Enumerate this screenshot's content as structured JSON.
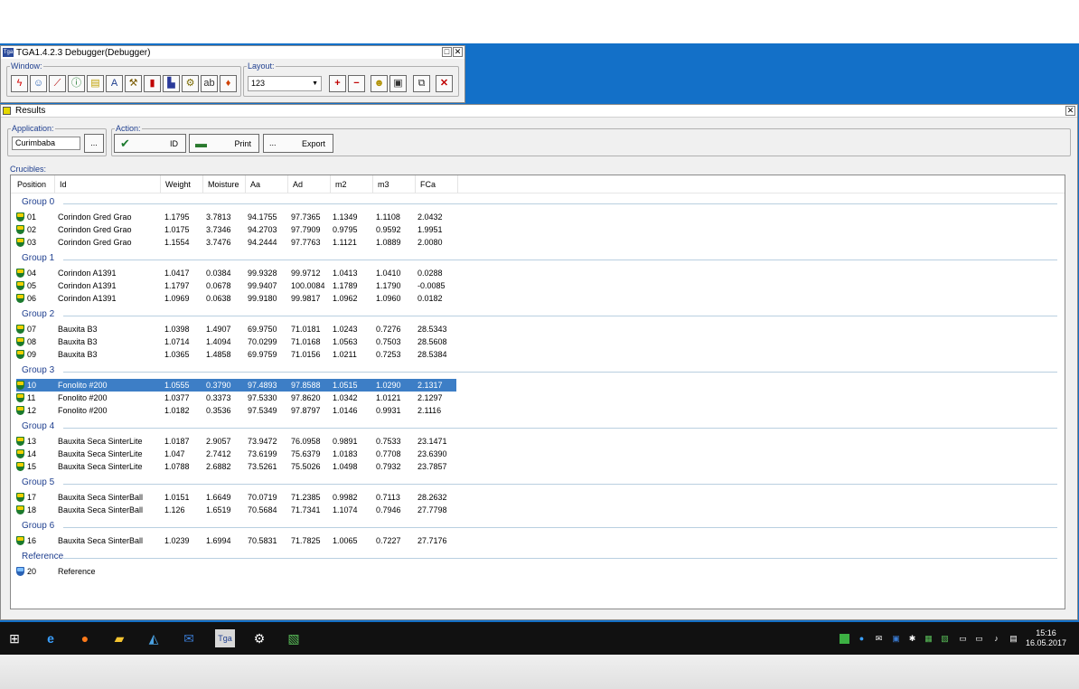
{
  "debugger": {
    "icon_text": "Tga",
    "title": "TGA1.4.2.3 Debugger(Debugger)",
    "window_label": "Window:",
    "layout_label": "Layout:",
    "layout_value": "123",
    "window_tools": [
      "lightning-icon",
      "smiley-icon",
      "chart-icon",
      "info-icon",
      "note-icon",
      "text-a-icon",
      "tool-icon",
      "battery-icon",
      "book-icon",
      "gear-icon",
      "abc-icon",
      "bell-icon"
    ],
    "layout_tools": [
      "plus-icon",
      "minus-icon",
      "yellow-face-icon",
      "screen-icon",
      "copy-icon",
      "close-icon"
    ]
  },
  "results": {
    "title": "Results",
    "application_label": "Application:",
    "application_value": "Curimbaba",
    "browse_label": "...",
    "action_label": "Action:",
    "id_button": "ID",
    "print_button": "Print",
    "export_button": "Export",
    "export_dots": "...",
    "crucibles_label": "Crucibles:",
    "columns": [
      "Position",
      "Id",
      "Weight",
      "Moisture",
      "Aa",
      "Ad",
      "m2",
      "m3",
      "FCa"
    ],
    "groups": [
      {
        "name": "Group 0",
        "rows": [
          {
            "pos": "01",
            "id": "Corindon Gred Grao",
            "weight": "1.1795",
            "moisture": "3.7813",
            "aa": "94.1755",
            "ad": "97.7365",
            "m2": "1.1349",
            "m3": "1.1108",
            "fca": "2.0432"
          },
          {
            "pos": "02",
            "id": "Corindon Gred Grao",
            "weight": "1.0175",
            "moisture": "3.7346",
            "aa": "94.2703",
            "ad": "97.7909",
            "m2": "0.9795",
            "m3": "0.9592",
            "fca": "1.9951"
          },
          {
            "pos": "03",
            "id": "Corindon Gred Grao",
            "weight": "1.1554",
            "moisture": "3.7476",
            "aa": "94.2444",
            "ad": "97.7763",
            "m2": "1.1121",
            "m3": "1.0889",
            "fca": "2.0080"
          }
        ]
      },
      {
        "name": "Group 1",
        "rows": [
          {
            "pos": "04",
            "id": "Corindon A1391",
            "weight": "1.0417",
            "moisture": "0.0384",
            "aa": "99.9328",
            "ad": "99.9712",
            "m2": "1.0413",
            "m3": "1.0410",
            "fca": "0.0288"
          },
          {
            "pos": "05",
            "id": "Corindon A1391",
            "weight": "1.1797",
            "moisture": "0.0678",
            "aa": "99.9407",
            "ad": "100.0084",
            "m2": "1.1789",
            "m3": "1.1790",
            "fca": "-0.0085"
          },
          {
            "pos": "06",
            "id": "Corindon A1391",
            "weight": "1.0969",
            "moisture": "0.0638",
            "aa": "99.9180",
            "ad": "99.9817",
            "m2": "1.0962",
            "m3": "1.0960",
            "fca": "0.0182"
          }
        ]
      },
      {
        "name": "Group 2",
        "rows": [
          {
            "pos": "07",
            "id": "Bauxita B3",
            "weight": "1.0398",
            "moisture": "1.4907",
            "aa": "69.9750",
            "ad": "71.0181",
            "m2": "1.0243",
            "m3": "0.7276",
            "fca": "28.5343"
          },
          {
            "pos": "08",
            "id": "Bauxita B3",
            "weight": "1.0714",
            "moisture": "1.4094",
            "aa": "70.0299",
            "ad": "71.0168",
            "m2": "1.0563",
            "m3": "0.7503",
            "fca": "28.5608"
          },
          {
            "pos": "09",
            "id": "Bauxita B3",
            "weight": "1.0365",
            "moisture": "1.4858",
            "aa": "69.9759",
            "ad": "71.0156",
            "m2": "1.0211",
            "m3": "0.7253",
            "fca": "28.5384"
          }
        ]
      },
      {
        "name": "Group 3",
        "rows": [
          {
            "pos": "10",
            "id": "Fonolito #200",
            "weight": "1.0555",
            "moisture": "0.3790",
            "aa": "97.4893",
            "ad": "97.8588",
            "m2": "1.0515",
            "m3": "1.0290",
            "fca": "2.1317",
            "selected": true
          },
          {
            "pos": "11",
            "id": "Fonolito #200",
            "weight": "1.0377",
            "moisture": "0.3373",
            "aa": "97.5330",
            "ad": "97.8620",
            "m2": "1.0342",
            "m3": "1.0121",
            "fca": "2.1297"
          },
          {
            "pos": "12",
            "id": "Fonolito #200",
            "weight": "1.0182",
            "moisture": "0.3536",
            "aa": "97.5349",
            "ad": "97.8797",
            "m2": "1.0146",
            "m3": "0.9931",
            "fca": "2.1116"
          }
        ]
      },
      {
        "name": "Group 4",
        "rows": [
          {
            "pos": "13",
            "id": "Bauxita Seca SinterLite",
            "weight": "1.0187",
            "moisture": "2.9057",
            "aa": "73.9472",
            "ad": "76.0958",
            "m2": "0.9891",
            "m3": "0.7533",
            "fca": "23.1471"
          },
          {
            "pos": "14",
            "id": "Bauxita Seca SinterLite",
            "weight": "1.047",
            "moisture": "2.7412",
            "aa": "73.6199",
            "ad": "75.6379",
            "m2": "1.0183",
            "m3": "0.7708",
            "fca": "23.6390"
          },
          {
            "pos": "15",
            "id": "Bauxita Seca SinterLite",
            "weight": "1.0788",
            "moisture": "2.6882",
            "aa": "73.5261",
            "ad": "75.5026",
            "m2": "1.0498",
            "m3": "0.7932",
            "fca": "23.7857"
          }
        ]
      },
      {
        "name": "Group 5",
        "rows": [
          {
            "pos": "17",
            "id": "Bauxita Seca SinterBall",
            "weight": "1.0151",
            "moisture": "1.6649",
            "aa": "70.0719",
            "ad": "71.2385",
            "m2": "0.9982",
            "m3": "0.7113",
            "fca": "28.2632"
          },
          {
            "pos": "18",
            "id": "Bauxita Seca SinterBall",
            "weight": "1.126",
            "moisture": "1.6519",
            "aa": "70.5684",
            "ad": "71.7341",
            "m2": "1.1074",
            "m3": "0.7946",
            "fca": "27.7798"
          }
        ]
      },
      {
        "name": "Group 6",
        "rows": [
          {
            "pos": "16",
            "id": "Bauxita Seca SinterBall",
            "weight": "1.0239",
            "moisture": "1.6994",
            "aa": "70.5831",
            "ad": "71.7825",
            "m2": "1.0065",
            "m3": "0.7227",
            "fca": "27.7176"
          }
        ]
      },
      {
        "name": "Reference",
        "rows": [
          {
            "pos": "20",
            "id": "Reference",
            "weight": "",
            "moisture": "",
            "aa": "",
            "ad": "",
            "m2": "",
            "m3": "",
            "fca": "",
            "reference": true
          }
        ]
      }
    ]
  },
  "taskbar": {
    "tga_label": "Tga",
    "time": "15:16",
    "date": "16.05.2017",
    "apps": [
      "windows-start-icon",
      "internet-explorer-icon",
      "firefox-icon",
      "file-explorer-icon",
      "chart-app-icon",
      "outlook-icon",
      "tga-app-icon",
      "settings-icon",
      "green-app-icon"
    ]
  }
}
